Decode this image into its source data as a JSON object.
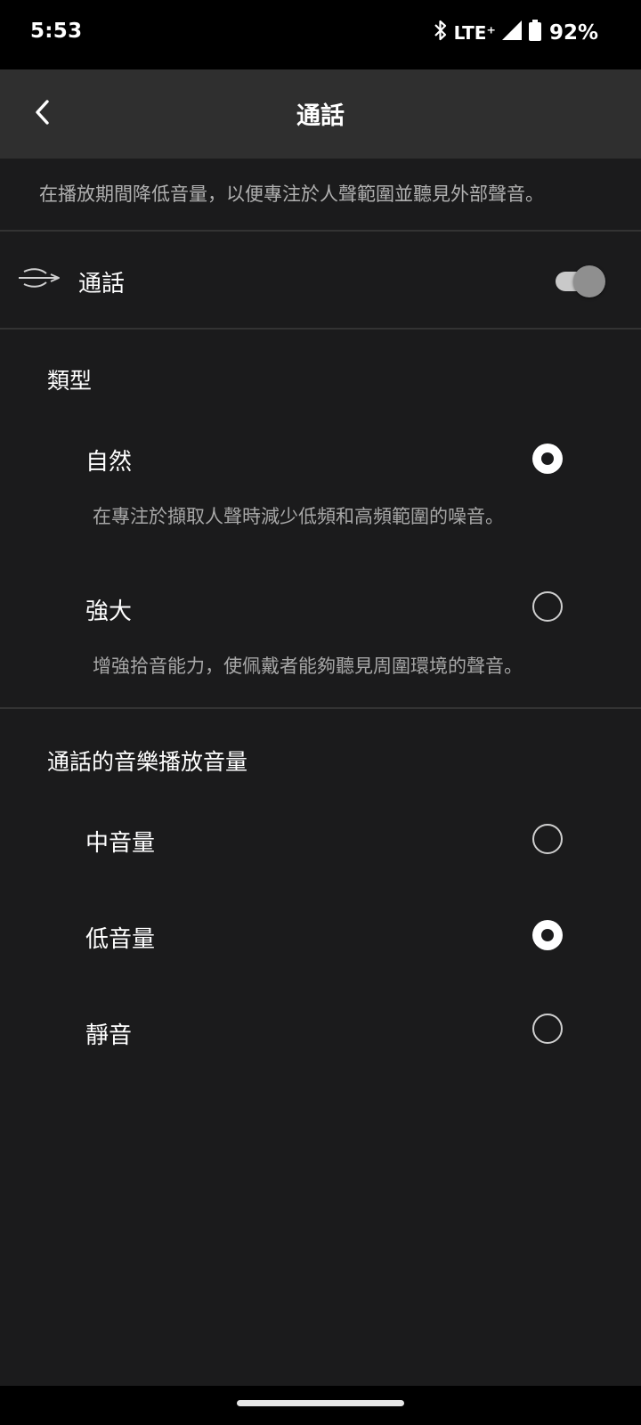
{
  "status_bar": {
    "time": "5:53",
    "network": "LTE⁺",
    "battery": "92%",
    "icons": [
      "bluetooth-icon",
      "signal-icon",
      "battery-icon"
    ]
  },
  "app_bar": {
    "title": "通話",
    "back_icon": "chevron-left-icon"
  },
  "description": "在播放期間降低音量，以便專注於人聲範圍並聽見外部聲音。",
  "main_toggle": {
    "label": "通話",
    "icon": "conversation-icon",
    "enabled": true
  },
  "type_section": {
    "title": "類型",
    "options": [
      {
        "label": "自然",
        "description": "在專注於擷取人聲時減少低頻和高頻範圍的噪音。",
        "selected": true
      },
      {
        "label": "強大",
        "description": "增強拾音能力，使佩戴者能夠聽見周圍環境的聲音。",
        "selected": false
      }
    ]
  },
  "volume_section": {
    "title": "通話的音樂播放音量",
    "options": [
      {
        "label": "中音量",
        "selected": false
      },
      {
        "label": "低音量",
        "selected": true
      },
      {
        "label": "靜音",
        "selected": false
      }
    ]
  },
  "colors": {
    "background": "#1b1b1c",
    "app_bar": "#2f2f2f",
    "secondary_text": "#b0b0b0"
  }
}
